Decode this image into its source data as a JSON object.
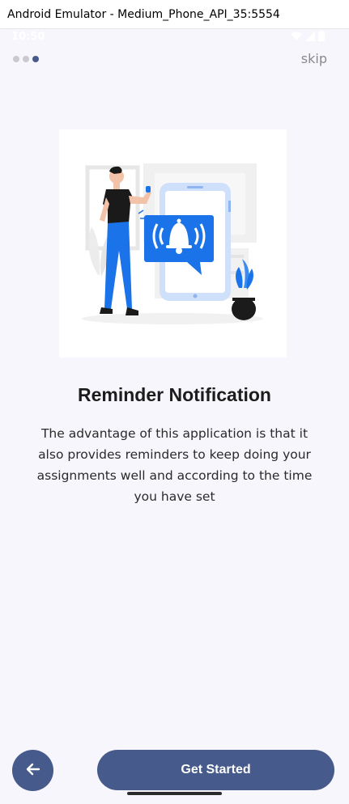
{
  "window": {
    "title": "Android Emulator - Medium_Phone_API_35:5554"
  },
  "statusbar": {
    "time": "10:50"
  },
  "onboarding": {
    "page_count": 3,
    "active_page": 3,
    "skip_label": "skip",
    "title": "Reminder Notification",
    "description": "The advantage of this application is that it also provides reminders to keep doing your assignments well and according to the time you have set",
    "back_icon": "arrow-left-icon",
    "primary_button_label": "Get Started"
  },
  "colors": {
    "background": "#f7f6fc",
    "accent": "#465a8c",
    "illustration_blue": "#1a73e8",
    "indicator_inactive": "#c9c9d0"
  }
}
